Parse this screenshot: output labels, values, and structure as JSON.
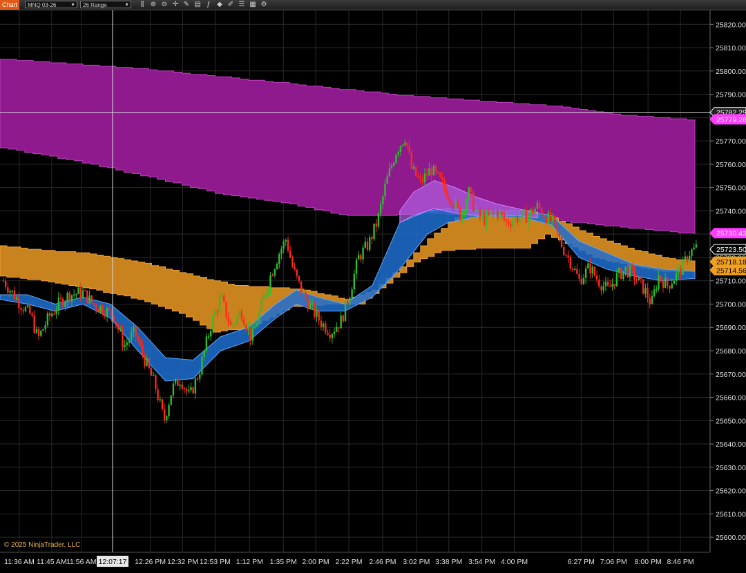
{
  "toolbar": {
    "tab_label": "Chart",
    "instrument": "MNQ 03-26",
    "bar_type": "26 Range",
    "icons": [
      "bars-icon",
      "zoom-in-icon",
      "zoom-out-icon",
      "crosshair-icon",
      "properties-icon",
      "data-box-icon",
      "indicators-icon",
      "strategies-icon",
      "drawing-tools-icon",
      "chart-trader-icon",
      "grid-icon",
      "settings-icon"
    ]
  },
  "copyright": "© 2025 NinjaTrader, LLC",
  "crosshair": {
    "time_label": "12:07:17",
    "price": 25782.25
  },
  "colors": {
    "background": "#000000",
    "grid": "#2a2a2a",
    "up_candle": "#2ebd2e",
    "down_candle": "#ff2a1a",
    "magenta_cloud": "#8e1a8e",
    "orange_cloud": "#c8821e",
    "blue_ribbon": "#1f6fd0",
    "purple_ribbon": "#b060e0",
    "crosshair": "#dcdcdc"
  },
  "chart_data": {
    "type": "candlestick",
    "instrument": "MNQ 03-26",
    "bar_type": "26 Range",
    "ylim": [
      25595,
      25826
    ],
    "y_ticks": [
      25600,
      25610,
      25620,
      25630,
      25640,
      25650,
      25660,
      25670,
      25680,
      25690,
      25700,
      25710,
      25720,
      25730,
      25740,
      25750,
      25760,
      25770,
      25780,
      25790,
      25800,
      25810,
      25820
    ],
    "y_tick_labels": [
      "25600.00",
      "25610.00",
      "25620.00",
      "25630.00",
      "25640.00",
      "25650.00",
      "25660.00",
      "25670.00",
      "25680.00",
      "25690.00",
      "25700.00",
      "25710.00",
      "25720.00",
      "25730.00",
      "25740.00",
      "25750.00",
      "25760.00",
      "25770.00",
      "25780.00",
      "25790.00",
      "25800.00",
      "25810.00",
      "25820.00"
    ],
    "x_range": [
      0,
      1030
    ],
    "x_ticks": [
      {
        "x": 28,
        "label": "11:36 AM"
      },
      {
        "x": 75,
        "label": "11:45 AM"
      },
      {
        "x": 118,
        "label": "11:56 AM"
      },
      {
        "x": 218,
        "label": "12:26 PM"
      },
      {
        "x": 265,
        "label": "12:32 PM"
      },
      {
        "x": 312,
        "label": "12:53 PM"
      },
      {
        "x": 362,
        "label": "1:12 PM"
      },
      {
        "x": 411,
        "label": "1:35 PM"
      },
      {
        "x": 458,
        "label": "2:00 PM"
      },
      {
        "x": 506,
        "label": "2:22 PM"
      },
      {
        "x": 555,
        "label": "2:46 PM"
      },
      {
        "x": 604,
        "label": "3:02 PM"
      },
      {
        "x": 651,
        "label": "3:38 PM"
      },
      {
        "x": 699,
        "label": "3:54 PM"
      },
      {
        "x": 746,
        "label": "4:00 PM"
      },
      {
        "x": 843,
        "label": "6:27 PM"
      },
      {
        "x": 890,
        "label": "7:06 PM"
      },
      {
        "x": 940,
        "label": "8:00 PM"
      },
      {
        "x": 987,
        "label": "8:46 PM"
      }
    ],
    "price_labels": [
      {
        "value": 25782.25,
        "label": "25782.25",
        "bg": "#222222",
        "fg": "#ffffff",
        "border": "#ffffff"
      },
      {
        "value": 25779.26,
        "label": "25779.26",
        "bg": "#ff3cff",
        "fg": "#ffffff",
        "border": "#ff3cff"
      },
      {
        "value": 25730.43,
        "label": "25730.43",
        "bg": "#ff3cff",
        "fg": "#ffffff",
        "border": "#ff3cff"
      },
      {
        "value": 25723.5,
        "label": "25723.50",
        "bg": "#000000",
        "fg": "#ffffff",
        "border": "#ffffff"
      },
      {
        "value": 25718.18,
        "label": "25718.18",
        "bg": "#f0a020",
        "fg": "#000000",
        "border": "#f0a020"
      },
      {
        "value": 25714.56,
        "label": "25714.56",
        "bg": "#f0a020",
        "fg": "#000000",
        "border": "#f0a020"
      }
    ],
    "magenta_band": {
      "upper": [
        [
          0,
          25805
        ],
        [
          100,
          25803
        ],
        [
          200,
          25801
        ],
        [
          300,
          25798
        ],
        [
          400,
          25795
        ],
        [
          500,
          25792
        ],
        [
          600,
          25789
        ],
        [
          700,
          25787
        ],
        [
          800,
          25785
        ],
        [
          900,
          25781
        ],
        [
          1008,
          25779
        ]
      ],
      "lower": [
        [
          0,
          25767
        ],
        [
          60,
          25764
        ],
        [
          130,
          25760
        ],
        [
          250,
          25752
        ],
        [
          320,
          25747
        ],
        [
          400,
          25744
        ],
        [
          500,
          25738
        ],
        [
          560,
          25738
        ],
        [
          620,
          25739
        ],
        [
          700,
          25738
        ],
        [
          800,
          25736
        ],
        [
          900,
          25733
        ],
        [
          1008,
          25730
        ]
      ]
    },
    "orange_band": {
      "upper": [
        [
          0,
          25725
        ],
        [
          60,
          25723
        ],
        [
          120,
          25722
        ],
        [
          200,
          25718
        ],
        [
          280,
          25712
        ],
        [
          340,
          25708
        ],
        [
          400,
          25707
        ],
        [
          440,
          25706
        ],
        [
          500,
          25702
        ],
        [
          540,
          25706
        ],
        [
          580,
          25716
        ],
        [
          620,
          25728
        ],
        [
          660,
          25737
        ],
        [
          700,
          25740
        ],
        [
          760,
          25740
        ],
        [
          800,
          25737
        ],
        [
          860,
          25729
        ],
        [
          920,
          25723
        ],
        [
          960,
          25720
        ],
        [
          1008,
          25718
        ]
      ],
      "lower": [
        [
          0,
          25712
        ],
        [
          60,
          25710
        ],
        [
          120,
          25707
        ],
        [
          200,
          25702
        ],
        [
          260,
          25696
        ],
        [
          310,
          25688
        ],
        [
          360,
          25690
        ],
        [
          420,
          25699
        ],
        [
          480,
          25700
        ],
        [
          520,
          25700
        ],
        [
          560,
          25709
        ],
        [
          600,
          25718
        ],
        [
          640,
          25723
        ],
        [
          700,
          25724
        ],
        [
          760,
          25724
        ],
        [
          790,
          25730
        ],
        [
          820,
          25726
        ],
        [
          860,
          25720
        ],
        [
          920,
          25716
        ],
        [
          960,
          25714
        ],
        [
          1008,
          25714
        ]
      ]
    },
    "blue_ribbon": {
      "upper": [
        [
          0,
          25704
        ],
        [
          40,
          25704
        ],
        [
          80,
          25700
        ],
        [
          120,
          25703
        ],
        [
          160,
          25700
        ],
        [
          200,
          25690
        ],
        [
          240,
          25677
        ],
        [
          280,
          25676
        ],
        [
          320,
          25686
        ],
        [
          360,
          25690
        ],
        [
          400,
          25700
        ],
        [
          430,
          25706
        ],
        [
          460,
          25703
        ],
        [
          500,
          25700
        ],
        [
          540,
          25708
        ],
        [
          580,
          25735
        ],
        [
          620,
          25740
        ],
        [
          650,
          25741
        ],
        [
          700,
          25740
        ],
        [
          760,
          25740
        ],
        [
          800,
          25738
        ],
        [
          840,
          25727
        ],
        [
          880,
          25722
        ],
        [
          920,
          25717
        ],
        [
          960,
          25715
        ],
        [
          1008,
          25714
        ]
      ],
      "lower": [
        [
          0,
          25702
        ],
        [
          40,
          25700
        ],
        [
          80,
          25697
        ],
        [
          120,
          25700
        ],
        [
          160,
          25694
        ],
        [
          200,
          25680
        ],
        [
          240,
          25667
        ],
        [
          280,
          25668
        ],
        [
          320,
          25680
        ],
        [
          360,
          25684
        ],
        [
          400,
          25694
        ],
        [
          430,
          25700
        ],
        [
          460,
          25697
        ],
        [
          500,
          25697
        ],
        [
          540,
          25703
        ],
        [
          580,
          25715
        ],
        [
          620,
          25730
        ],
        [
          650,
          25735
        ],
        [
          700,
          25738
        ],
        [
          760,
          25737
        ],
        [
          800,
          25734
        ],
        [
          840,
          25720
        ],
        [
          880,
          25715
        ],
        [
          920,
          25712
        ],
        [
          960,
          25710
        ],
        [
          1008,
          25711
        ]
      ]
    },
    "purple_ribbon": {
      "upper": [
        [
          580,
          25740
        ],
        [
          600,
          25748
        ],
        [
          630,
          25753
        ],
        [
          660,
          25750
        ],
        [
          690,
          25746
        ],
        [
          720,
          25743
        ],
        [
          750,
          25741
        ],
        [
          780,
          25739
        ]
      ],
      "lower": [
        [
          580,
          25735
        ],
        [
          600,
          25738
        ],
        [
          630,
          25741
        ],
        [
          660,
          25739
        ],
        [
          690,
          25738
        ],
        [
          720,
          25738
        ],
        [
          750,
          25738
        ],
        [
          780,
          25737
        ]
      ]
    },
    "price_path": [
      [
        0,
        25712
      ],
      [
        15,
        25706
      ],
      [
        30,
        25700
      ],
      [
        45,
        25695
      ],
      [
        55,
        25685
      ],
      [
        70,
        25694
      ],
      [
        85,
        25700
      ],
      [
        100,
        25704
      ],
      [
        120,
        25705
      ],
      [
        135,
        25700
      ],
      [
        150,
        25698
      ],
      [
        165,
        25695
      ],
      [
        180,
        25682
      ],
      [
        195,
        25688
      ],
      [
        210,
        25676
      ],
      [
        225,
        25665
      ],
      [
        238,
        25650
      ],
      [
        250,
        25664
      ],
      [
        262,
        25668
      ],
      [
        275,
        25660
      ],
      [
        290,
        25672
      ],
      [
        305,
        25690
      ],
      [
        320,
        25703
      ],
      [
        335,
        25690
      ],
      [
        350,
        25697
      ],
      [
        365,
        25685
      ],
      [
        380,
        25700
      ],
      [
        392,
        25712
      ],
      [
        405,
        25722
      ],
      [
        415,
        25728
      ],
      [
        425,
        25715
      ],
      [
        438,
        25705
      ],
      [
        452,
        25698
      ],
      [
        466,
        25692
      ],
      [
        480,
        25688
      ],
      [
        495,
        25693
      ],
      [
        505,
        25702
      ],
      [
        520,
        25720
      ],
      [
        535,
        25726
      ],
      [
        548,
        25736
      ],
      [
        560,
        25752
      ],
      [
        575,
        25766
      ],
      [
        588,
        25772
      ],
      [
        597,
        25758
      ],
      [
        610,
        25752
      ],
      [
        625,
        25758
      ],
      [
        640,
        25752
      ],
      [
        655,
        25745
      ],
      [
        668,
        25738
      ],
      [
        680,
        25748
      ],
      [
        692,
        25738
      ],
      [
        705,
        25736
      ],
      [
        720,
        25740
      ],
      [
        735,
        25735
      ],
      [
        750,
        25737
      ],
      [
        765,
        25738
      ],
      [
        780,
        25742
      ],
      [
        790,
        25738
      ],
      [
        802,
        25735
      ],
      [
        815,
        25725
      ],
      [
        828,
        25718
      ],
      [
        840,
        25710
      ],
      [
        855,
        25716
      ],
      [
        868,
        25710
      ],
      [
        882,
        25706
      ],
      [
        895,
        25712
      ],
      [
        908,
        25715
      ],
      [
        920,
        25712
      ],
      [
        935,
        25706
      ],
      [
        945,
        25700
      ],
      [
        955,
        25712
      ],
      [
        968,
        25708
      ],
      [
        980,
        25712
      ],
      [
        990,
        25716
      ],
      [
        1000,
        25722
      ],
      [
        1010,
        25724
      ]
    ]
  }
}
